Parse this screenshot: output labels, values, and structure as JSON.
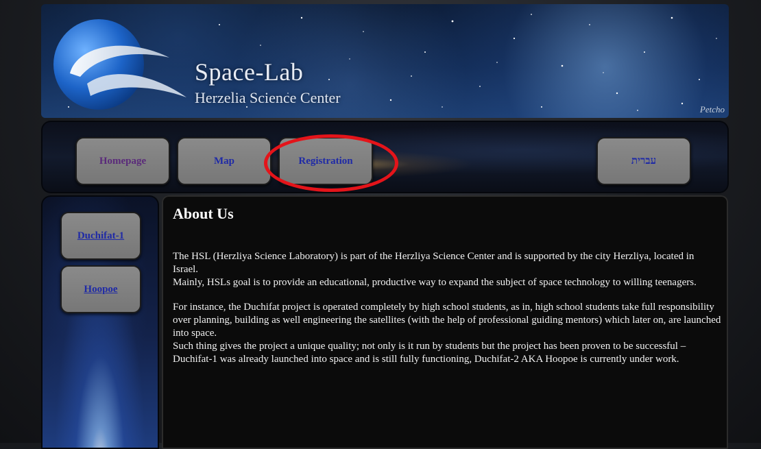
{
  "header": {
    "title": "Space-Lab",
    "subtitle": "Herzelia Science Center",
    "signature": "Petcho"
  },
  "nav": {
    "items": [
      {
        "label": "Homepage",
        "state": "visited"
      },
      {
        "label": "Map",
        "state": "normal"
      },
      {
        "label": "Registration",
        "state": "normal",
        "highlighted": true
      },
      {
        "label": "עברית",
        "state": "normal"
      }
    ],
    "highlight_color": "#e4141a"
  },
  "sidebar": {
    "links": [
      {
        "label": "Duchifat-1"
      },
      {
        "label": "Hoopoe"
      }
    ]
  },
  "main": {
    "heading": "About Us",
    "paragraphs": [
      "The HSL (Herzliya Science Laboratory) is part of the Herzliya Science Center and is supported by the city Herzliya, located in Israel.",
      "Mainly, HSLs goal is to provide an educational, productive way to expand the subject of space technology to willing teenagers.",
      "For instance, the Duchifat project is operated completely by high school students, as in, high school students take full responsibility over planning, building as well engineering the satellites (with the help of professional guiding mentors) which later on, are launched into space.",
      "Such thing gives the project a unique quality; not only is it run by students but the project has been proven to be successful – Duchifat-1 was already launched into space and is still fully functioning, Duchifat-2 AKA Hoopoe is currently under work."
    ]
  },
  "colors": {
    "link": "#1f2aa6",
    "visited_link": "#5a2a7a",
    "button_bg": "#808080",
    "content_bg": "#0b0b0b"
  }
}
